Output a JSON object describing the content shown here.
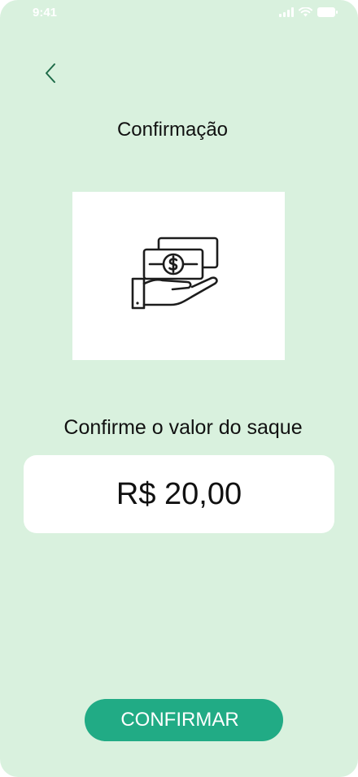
{
  "status_bar": {
    "time": "9:41",
    "icons": [
      "signal-icon",
      "wifi-icon",
      "battery-icon"
    ]
  },
  "header": {
    "back_icon": "chevron-left-icon",
    "title": "Confirmação"
  },
  "illustration": {
    "icon": "hand-money-icon"
  },
  "main": {
    "prompt": "Confirme o valor do saque",
    "amount": "R$ 20,00"
  },
  "footer": {
    "confirm_label": "CONFIRMAR"
  },
  "colors": {
    "background": "#d9f1de",
    "accent": "#21ab85",
    "back_icon": "#1e6b48",
    "card": "#ffffff",
    "text": "#111111"
  }
}
